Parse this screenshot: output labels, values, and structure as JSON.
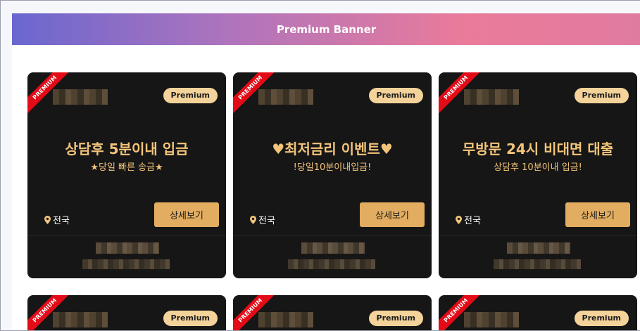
{
  "header": {
    "title": "Premium Banner"
  },
  "cards": [
    {
      "ribbon": "PREMIUM",
      "badge": "Premium",
      "headline": "상담후 5분이내 입금",
      "subline": "★당일 빠른 송금★",
      "location": "전국",
      "button": "상세보기"
    },
    {
      "ribbon": "PREMIUM",
      "badge": "Premium",
      "headline": "♥최저금리 이벤트♥",
      "subline": "!당일10분이내입금!",
      "location": "전국",
      "button": "상세보기"
    },
    {
      "ribbon": "PREMIUM",
      "badge": "Premium",
      "headline": "무방문 24시 비대면 대출",
      "subline": "상담후 10분이내 입금!",
      "location": "전국",
      "button": "상세보기"
    }
  ],
  "next_row": [
    {
      "ribbon": "PREMIUM",
      "badge": "Premium"
    },
    {
      "ribbon": "PREMIUM",
      "badge": "Premium"
    },
    {
      "ribbon": "PREMIUM",
      "badge": "Premium"
    }
  ],
  "colors": {
    "card_bg": "#161616",
    "accent_gold": "#f2c47a",
    "button_bg": "#e2ad60",
    "ribbon_red": "#e30b17"
  }
}
